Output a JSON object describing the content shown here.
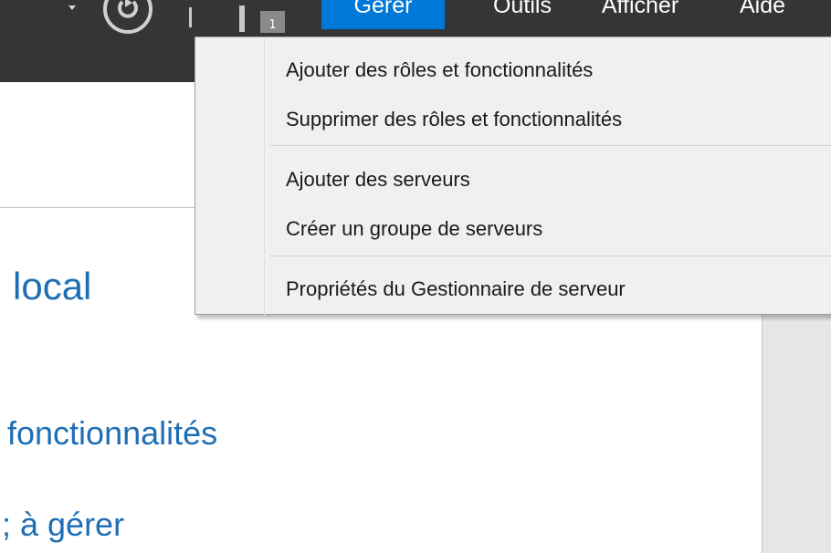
{
  "toolbar": {
    "notification_count": "1",
    "menu": [
      "Gérer",
      "Outils",
      "Afficher",
      "Aide"
    ],
    "active_menu": "Gérer"
  },
  "dropdown": {
    "items": [
      "Ajouter des rôles et fonctionnalités",
      "Supprimer des rôles et fonctionnalités",
      "Ajouter des serveurs",
      "Créer un groupe de serveurs",
      "Propriétés du Gestionnaire de serveur"
    ]
  },
  "background": {
    "title_fragment": "local",
    "link_1_fragment": "fonctionnalités",
    "link_2_fragment": "; à gérer"
  },
  "colors": {
    "toolbar_bg": "#353535",
    "active_menu_bg": "#0078d7",
    "link_text": "#1e6eb5",
    "menu_bg": "#f0f0f0"
  },
  "icons": [
    "dropdown-arrow-icon",
    "refresh-icon",
    "flag-icon"
  ]
}
